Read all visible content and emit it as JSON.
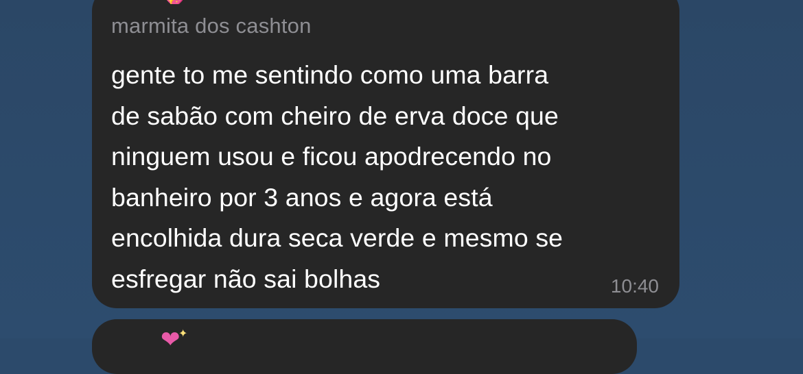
{
  "chat": {
    "message": {
      "sender": "marmita dos cashton",
      "lines": [
        "gente to me sentindo como uma barra",
        "de sabão com cheiro de erva doce que",
        "ninguem usou e ficou apodrecendo no",
        "banheiro por 3 anos e agora está",
        "encolhida dura seca verde e mesmo se",
        "esfregar não sai bolhas"
      ],
      "time": "10:40"
    },
    "icons": {
      "top": "sparkling-heart-icon",
      "bottom": "sparkling-heart-icon"
    },
    "colors": {
      "background": "#2c4a6b",
      "bubble": "#262626",
      "text": "#ffffff",
      "meta": "#8e8e93"
    }
  }
}
